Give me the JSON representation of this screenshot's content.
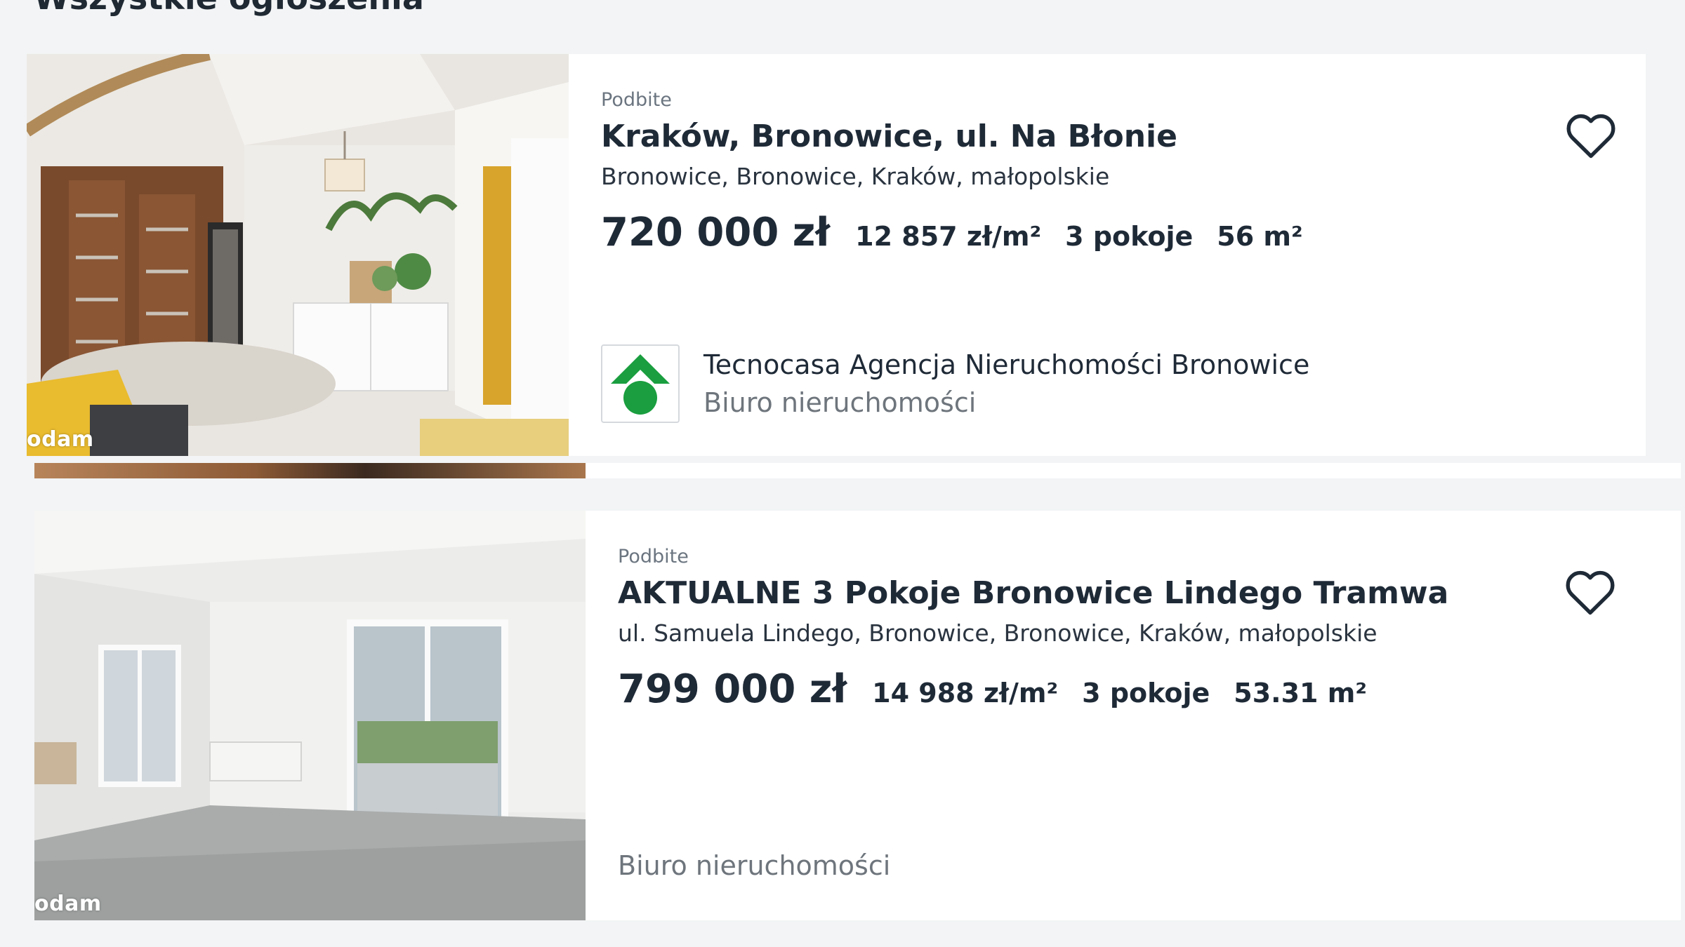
{
  "section": {
    "heading": "Wszystkie ogłoszenia"
  },
  "listings": [
    {
      "badge": "Podbite",
      "title": "Kraków, Bronowice, ul. Na Błonie",
      "address": "Bronowice, Bronowice, Kraków, małopolskie",
      "price": "720 000 zł",
      "price_per_m2": "12 857 zł/m²",
      "rooms": "3 pokoje",
      "area": "56 m²",
      "agency_name": "Tecnocasa Agencja Nieruchomości Bronowice",
      "agency_type": "Biuro nieruchomości",
      "watermark": "odam",
      "favorite_icon": "heart-outline-icon"
    },
    {
      "badge": "Podbite",
      "title": "AKTUALNE 3 Pokoje Bronowice Lindego Tramwa",
      "address": "ul. Samuela Lindego, Bronowice, Bronowice, Kraków, małopolskie",
      "price": "799 000 zł",
      "price_per_m2": "14 988 zł/m²",
      "rooms": "3 pokoje",
      "area": "53.31 m²",
      "agency_type": "Biuro nieruchomości",
      "watermark": "odam",
      "favorite_icon": "heart-outline-icon"
    }
  ],
  "colors": {
    "page_background": "#f2f4f5",
    "card_background": "#ffffff",
    "text_primary": "#1f2a37",
    "text_muted": "#6e757c",
    "agency_logo_green": "#1a9e3f"
  }
}
